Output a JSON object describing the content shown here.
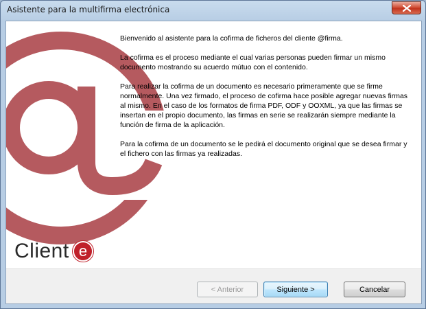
{
  "window": {
    "title": "Asistente para la multifirma electrónica"
  },
  "content": {
    "paragraphs": [
      "Bienvenido al asistente para la cofirma de ficheros del cliente @firma.",
      "La cofirma es el proceso mediante el cual varias personas pueden firmar un mismo documento mostrando su acuerdo mútuo con el contenido.",
      "Para realizar la cofirma de un documento es necesario primeramente que se firme normalmente. Una vez firmado, el proceso de cofirma hace posible agregar nuevas firmas al mismo. En el caso de los formatos de firma PDF, ODF y OOXML, ya que las firmas se insertan en el propio documento, las firmas en serie se realizarán siempre mediante la función de firma de la aplicación.",
      "Para la cofirma de un documento se le pedirá el documento original que se desea firmar y el fichero con las firmas ya realizadas."
    ]
  },
  "brand": {
    "word": "Client",
    "letter": "e"
  },
  "buttons": {
    "previous": "< Anterior",
    "next": "Siguiente >",
    "cancel": "Cancelar"
  },
  "colors": {
    "logo_red": "#b55a5f",
    "brand_red": "#c0202a"
  },
  "icons": {
    "background_logo": "at-sign-icon",
    "close": "close-icon"
  }
}
